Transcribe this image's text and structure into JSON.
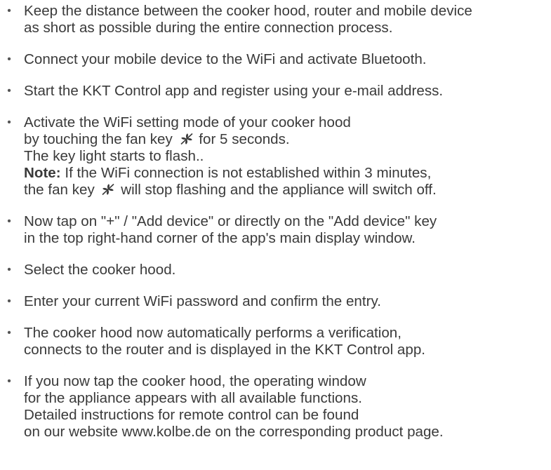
{
  "items": [
    {
      "lines": [
        "Keep the distance between the cooker hood, router and mobile device",
        "as short as possible during the entire connection process."
      ]
    },
    {
      "lines": [
        "Connect your mobile device to the WiFi and activate Bluetooth."
      ]
    },
    {
      "lines": [
        "Start the KKT Control app and register using your e-mail address."
      ]
    },
    {
      "line1": "Activate the WiFi setting mode of your cooker hood",
      "line2_before": "by touching the fan key",
      "line2_after": "for 5 seconds.",
      "line3": "The key light starts to flash..",
      "note_label": "Note:",
      "note_text": " If the WiFi connection is not established within 3 minutes,",
      "line5_before": "the fan key",
      "line5_after": "will stop flashing and the appliance will switch off."
    },
    {
      "lines": [
        "Now tap on  \"+\" / \"Add device\" or directly on the \"Add device\" key",
        "in the top right-hand corner of the app's main display window."
      ]
    },
    {
      "lines": [
        "Select the cooker hood."
      ]
    },
    {
      "lines": [
        "Enter your current WiFi password and confirm the entry."
      ]
    },
    {
      "lines": [
        "The cooker hood now automatically performs a verification,",
        "connects to the router and is displayed in the KKT Control app."
      ]
    },
    {
      "lines": [
        "If you now tap the cooker hood, the operating window",
        "for the appliance appears with all available functions.",
        "Detailed instructions for remote control can be found",
        "on our website www.kolbe.de on the corresponding product page."
      ]
    }
  ],
  "bullet_char": "•",
  "icons": {
    "fan_key": "fan-icon"
  }
}
